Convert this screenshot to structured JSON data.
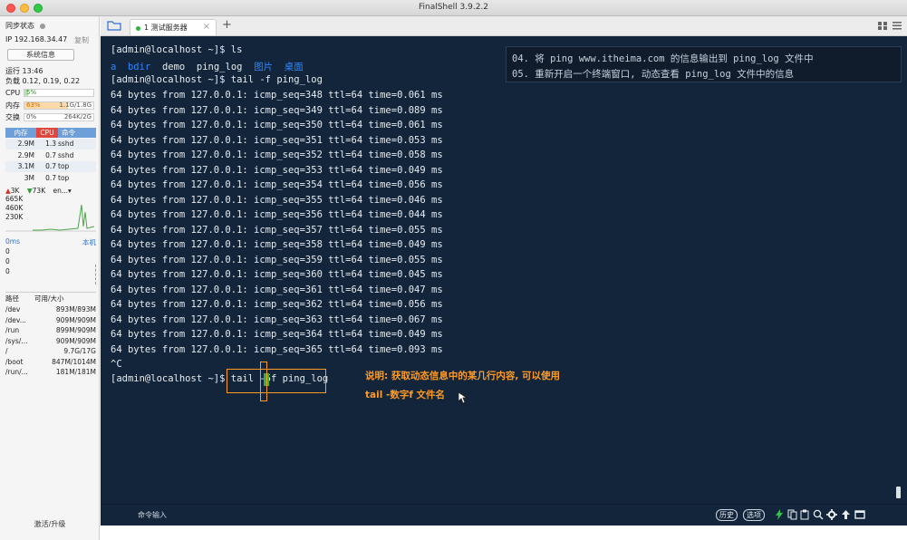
{
  "window": {
    "title": "FinalShell 3.9.2.2"
  },
  "sidebar": {
    "sync_label": "同步状态",
    "ip": "IP 192.168.34.47",
    "copy_label": "复制",
    "sys_info_button": "系统信息",
    "uptime": "运行 13:46",
    "load": "负载 0.12, 0.19, 0.22",
    "cpu_label": "CPU",
    "cpu_value": "5%",
    "cpu_percent": 5,
    "mem_label": "内存",
    "mem_percent_text": "63%",
    "mem_value": "1.1G/1.8G",
    "mem_percent": 63,
    "swap_label": "交换",
    "swap_percent_text": "0%",
    "swap_value": "264K/2G",
    "swap_percent": 0,
    "proc_headers": [
      "内存",
      "CPU",
      "命令"
    ],
    "processes": [
      {
        "mem": "2.9M",
        "cpu": "1.3",
        "cmd": "sshd"
      },
      {
        "mem": "2.9M",
        "cpu": "0.7",
        "cmd": "sshd"
      },
      {
        "mem": "3.1M",
        "cpu": "0.7",
        "cmd": "top"
      },
      {
        "mem": "3M",
        "cpu": "0.7",
        "cmd": "top"
      }
    ],
    "net_up": "3K",
    "net_down": "73K",
    "net_iface": "en...",
    "net_scale": [
      "665K",
      "460K",
      "230K"
    ],
    "latency_label": "0ms",
    "latency_target": "本机",
    "latency_values": [
      "0",
      "0",
      "0"
    ],
    "disk_headers": [
      "路径",
      "可用/大小"
    ],
    "disks": [
      {
        "path": "/dev",
        "usage": "893M/893M"
      },
      {
        "path": "/dev...",
        "usage": "909M/909M"
      },
      {
        "path": "/run",
        "usage": "899M/909M"
      },
      {
        "path": "/sys/...",
        "usage": "909M/909M"
      },
      {
        "path": "/",
        "usage": "9.7G/17G"
      },
      {
        "path": "/boot",
        "usage": "847M/1014M"
      },
      {
        "path": "/run/...",
        "usage": "181M/181M"
      }
    ],
    "activate_label": "激活/升级"
  },
  "tabs": [
    {
      "label": "1 测试服务器"
    }
  ],
  "terminal": {
    "prompt1": "[admin@localhost ~]$ ls",
    "ls_items": [
      {
        "name": "a",
        "kind": "dir"
      },
      {
        "name": "bdir",
        "kind": "dir"
      },
      {
        "name": "demo",
        "kind": "file"
      },
      {
        "name": "ping_log",
        "kind": "file"
      },
      {
        "name": "图片",
        "kind": "dir"
      },
      {
        "name": "桌面",
        "kind": "dir"
      }
    ],
    "prompt2": "[admin@localhost ~]$ tail -f ping_log",
    "ping_lines": [
      "64 bytes from 127.0.0.1: icmp_seq=348 ttl=64 time=0.061 ms",
      "64 bytes from 127.0.0.1: icmp_seq=349 ttl=64 time=0.089 ms",
      "64 bytes from 127.0.0.1: icmp_seq=350 ttl=64 time=0.061 ms",
      "64 bytes from 127.0.0.1: icmp_seq=351 ttl=64 time=0.053 ms",
      "64 bytes from 127.0.0.1: icmp_seq=352 ttl=64 time=0.058 ms",
      "64 bytes from 127.0.0.1: icmp_seq=353 ttl=64 time=0.049 ms",
      "64 bytes from 127.0.0.1: icmp_seq=354 ttl=64 time=0.056 ms",
      "64 bytes from 127.0.0.1: icmp_seq=355 ttl=64 time=0.046 ms",
      "64 bytes from 127.0.0.1: icmp_seq=356 ttl=64 time=0.044 ms",
      "64 bytes from 127.0.0.1: icmp_seq=357 ttl=64 time=0.055 ms",
      "64 bytes from 127.0.0.1: icmp_seq=358 ttl=64 time=0.049 ms",
      "64 bytes from 127.0.0.1: icmp_seq=359 ttl=64 time=0.055 ms",
      "64 bytes from 127.0.0.1: icmp_seq=360 ttl=64 time=0.045 ms",
      "64 bytes from 127.0.0.1: icmp_seq=361 ttl=64 time=0.047 ms",
      "64 bytes from 127.0.0.1: icmp_seq=362 ttl=64 time=0.056 ms",
      "64 bytes from 127.0.0.1: icmp_seq=363 ttl=64 time=0.067 ms",
      "64 bytes from 127.0.0.1: icmp_seq=364 ttl=64 time=0.049 ms",
      "64 bytes from 127.0.0.1: icmp_seq=365 ttl=64 time=0.093 ms"
    ],
    "ctrl_c": "^C",
    "prompt3_prefix": "[admin@localhost ~]$ ",
    "prompt3_cmd": "tail -5f ping_log",
    "hint_lines": [
      "04. 将 ping www.itheima.com 的信息输出到 ping_log 文件中",
      "05. 重新开启一个终端窗口, 动态查看 ping_log 文件中的信息"
    ],
    "note_lines": [
      "说明: 获取动态信息中的某几行内容, 可以使用",
      "tail -数字f 文件名"
    ]
  },
  "cmdbar": {
    "input_label": "命令输入",
    "history_button": "历史",
    "options_button": "选项"
  },
  "colors": {
    "terminal_bg": "#13253a",
    "terminal_text": "#e7ecf1",
    "ls_dir": "#2f86ff",
    "note_orange": "#ff9a25",
    "cursor_green": "#2fb344"
  }
}
